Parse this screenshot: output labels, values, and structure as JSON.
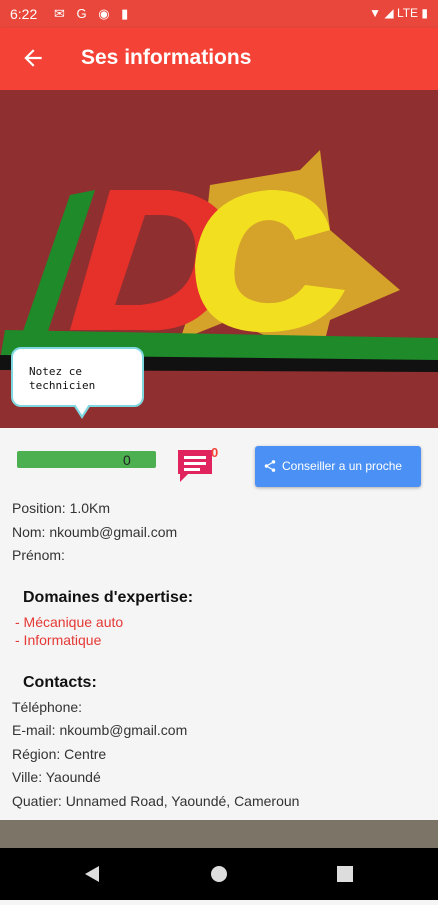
{
  "status_bar": {
    "time": "6:22",
    "network": "LTE"
  },
  "app_bar": {
    "title": "Ses informations"
  },
  "tooltip": {
    "text_line1": "Notez ce",
    "text_line2": "technicien"
  },
  "rating": {
    "value": "0"
  },
  "messages": {
    "count": "0"
  },
  "share_button": {
    "label": "Conseiller a un proche"
  },
  "info": {
    "position": "Position: 1.0Km",
    "nom": "Nom: nkoumb@gmail.com",
    "prenom": "Prénom:"
  },
  "expertise": {
    "heading": "Domaines d'expertise:",
    "items": [
      "- Mécanique auto",
      "- Informatique"
    ]
  },
  "contacts": {
    "heading": "Contacts:",
    "telephone": "Téléphone:",
    "email": "E-mail: nkoumb@gmail.com",
    "region": "Région: Centre",
    "ville": "Ville: Yaoundé",
    "quartier": "Quatier: Unnamed Road, Yaoundé, Cameroun"
  },
  "colors": {
    "primary": "#f44336",
    "accent_blue": "#4a90f5",
    "rating_green": "#4caf50"
  }
}
